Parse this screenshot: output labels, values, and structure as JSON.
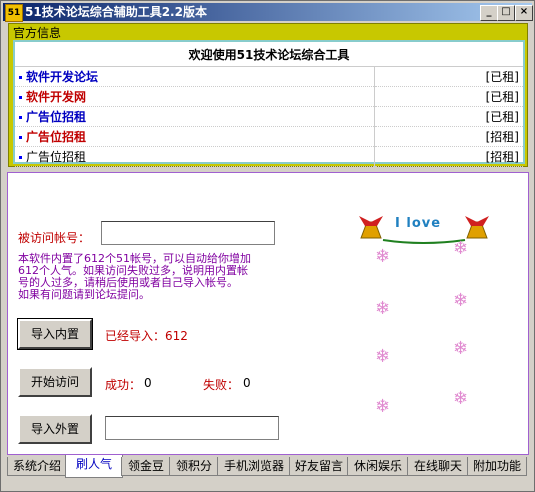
{
  "window": {
    "title": "51技术论坛综合辅助工具2.2版本",
    "icon_label": "51",
    "min_symbol": "_",
    "max_symbol": "□",
    "close_symbol": "×"
  },
  "announcement": {
    "group_label": "官方信息",
    "header": "欢迎使用51技术论坛综合工具",
    "rows": [
      {
        "name": "软件开发论坛",
        "status": "[已租]",
        "color": "#0000c0"
      },
      {
        "name": "软件开发网",
        "status": "[已租]",
        "color": "#c00000"
      },
      {
        "name": "广告位招租",
        "status": "[已租]",
        "color": "#0000c0"
      },
      {
        "name": "广告位招租",
        "status": "[招租]",
        "color": "#c00000"
      },
      {
        "name": "广告位招租",
        "status": "[招租]",
        "color": "#000000"
      }
    ]
  },
  "main": {
    "account_label": "被访问帐号：",
    "account_value": "",
    "info_lines": [
      "本软件内置了612个51帐号，可以自动给你增加",
      "612个人气。如果访问失败过多，说明用内置帐",
      "号的人过多，请稍后使用或者自己导入帐号。",
      "如果有问题请到论坛提问。"
    ],
    "import_internal_button": "导入内置",
    "imported_text": "已经导入：612",
    "start_button": "开始访问",
    "success_label": "成功：",
    "success_value": "0",
    "fail_label": "失败：",
    "fail_value": "0",
    "import_external_button": "导入外置",
    "external_path": "",
    "decor_text": "I love"
  },
  "tabs": [
    {
      "label": "系统介绍",
      "active": false
    },
    {
      "label": "刷人气",
      "active": true
    },
    {
      "label": "领金豆",
      "active": false
    },
    {
      "label": "领积分",
      "active": false
    },
    {
      "label": "手机浏览器",
      "active": false
    },
    {
      "label": "好友留言",
      "active": false
    },
    {
      "label": "休闲娱乐",
      "active": false
    },
    {
      "label": "在线聊天",
      "active": false
    },
    {
      "label": "附加功能",
      "active": false
    }
  ],
  "colors": {
    "title_bar": "#0a246a",
    "info_text": "#8000a0",
    "label_red": "#c00000",
    "yellow_frame": "#c8c800",
    "panel_border": "#a060d0",
    "snowflake": "#e08ad0"
  }
}
